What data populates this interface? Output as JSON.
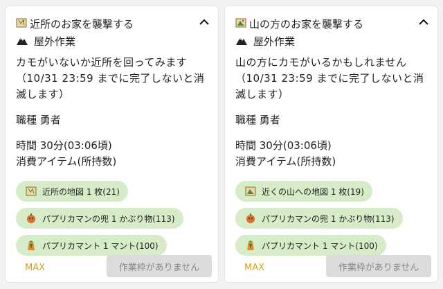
{
  "cards": [
    {
      "title": "近所のお家を襲撃する",
      "category": "屋外作業",
      "description": "カモがいないか近所を回ってみます（10/31 23:59 までに完了しないと消滅します）",
      "job": "職種 勇者",
      "time": "時間 30分(03:06頃)",
      "items_label": "消費アイテム(所持数)",
      "items": [
        {
          "label": "近所の地図 1 枚(21)",
          "icon": "map-icon"
        },
        {
          "label": "パプリカマンの兜 1 かぶり物(113)",
          "icon": "paprika-helmet-icon"
        },
        {
          "label": "パプリカマント 1 マント(100)",
          "icon": "paprika-cloak-icon"
        }
      ],
      "max_label": "MAX",
      "action_label": "作業枠がありません"
    },
    {
      "title": "山の方のお家を襲撃する",
      "category": "屋外作業",
      "description": "山の方にカモがいるかもしれません（10/31 23:59 までに完了しないと消滅します）",
      "job": "職種 勇者",
      "time": "時間 30分(03:06頃)",
      "items_label": "消費アイテム(所持数)",
      "items": [
        {
          "label": "近くの山への地図 1 枚(19)",
          "icon": "mountain-map-icon"
        },
        {
          "label": "パプリカマンの兜 1 かぶり物(113)",
          "icon": "paprika-helmet-icon"
        },
        {
          "label": "パプリカマント 1 マント(100)",
          "icon": "paprika-cloak-icon"
        }
      ],
      "max_label": "MAX",
      "action_label": "作業枠がありません"
    }
  ],
  "colors": {
    "chip_bg": "#d6ecc8",
    "max_text": "#d6a219",
    "disabled_button": "#dcdcdc"
  }
}
